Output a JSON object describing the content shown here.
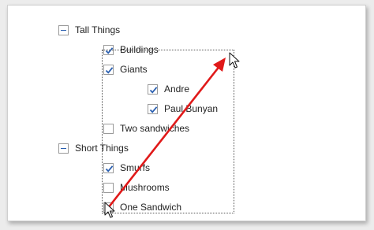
{
  "tree": {
    "groups": [
      {
        "label": "Tall Things",
        "expanded": true,
        "items": [
          {
            "label": "Buildings",
            "checked": true
          },
          {
            "label": "Giants",
            "checked": true,
            "children": [
              {
                "label": "Andre",
                "checked": true
              },
              {
                "label": "Paul Bunyan",
                "checked": true
              }
            ]
          },
          {
            "label": "Two sandwiches",
            "checked": false
          }
        ]
      },
      {
        "label": "Short Things",
        "expanded": true,
        "items": [
          {
            "label": "Smurfs",
            "checked": true
          },
          {
            "label": "Mushrooms",
            "checked": false
          },
          {
            "label": "One Sandwich",
            "checked": false
          }
        ]
      }
    ]
  },
  "colors": {
    "check": "#2a5fb0",
    "arrow": "#e01919"
  }
}
